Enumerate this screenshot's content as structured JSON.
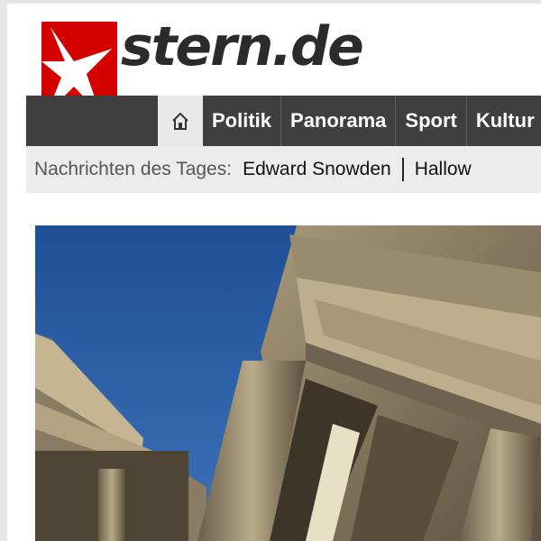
{
  "brand": {
    "name": "stern.de",
    "accent": "#d40000"
  },
  "nav": {
    "home_icon": "home-icon",
    "items": [
      "Politik",
      "Panorama",
      "Sport",
      "Kultur"
    ]
  },
  "ticker": {
    "label": "Nachrichten des Tages:",
    "links": [
      "Edward Snowden",
      "Hallow"
    ]
  },
  "hero": {
    "image": "brandenburg-gate-photo"
  }
}
